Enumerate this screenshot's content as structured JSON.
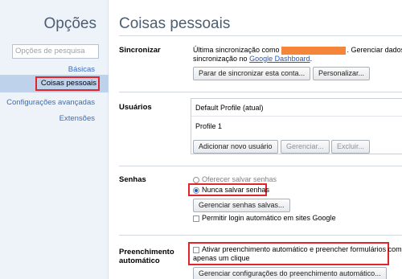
{
  "sidebar": {
    "title": "Opções",
    "search_placeholder": "Opções de pesquisa",
    "items": [
      {
        "label": "Básicas"
      },
      {
        "label": "Coisas pessoais"
      },
      {
        "label": "Configurações avançadas"
      },
      {
        "label": "Extensões"
      }
    ],
    "selected_item": "Coisas pessoais"
  },
  "main": {
    "title": "Coisas pessoais",
    "sync": {
      "label": "Sincronizar",
      "status_prefix": "Última sincronização como",
      "status_suffix": ". Gerenciar dados de",
      "status_line2": "sincronização no",
      "dashboard_link": "Google Dashboard",
      "status_end": ".",
      "stop_button": "Parar de sincronizar esta conta...",
      "customize_button": "Personalizar..."
    },
    "users": {
      "label": "Usuários",
      "profiles": [
        "Default Profile (atual)",
        "Profile 1"
      ],
      "add_button": "Adicionar novo usuário",
      "manage_button": "Gerenciar...",
      "delete_button": "Excluir..."
    },
    "passwords": {
      "label": "Senhas",
      "offer_option": "Oferecer salvar senhas",
      "never_option": "Nunca salvar senhas",
      "selected_option": "Nunca salvar senhas",
      "manage_button": "Gerenciar senhas salvas...",
      "auto_login": "Permitir login automático em sites Google",
      "auto_login_checked": false
    },
    "autofill": {
      "label_line1": "Preenchimento",
      "label_line2": "automático",
      "enable_line1": "Ativar preenchimento automático e preencher formulários com",
      "enable_line2": "apenas um clique",
      "enable_checked": false,
      "manage_button": "Gerenciar configurações do preenchimento automático..."
    }
  },
  "colors": {
    "highlight_border": "#e0262a",
    "redaction": "#f58539",
    "sidebar_bg": "#eef3fa",
    "selected_nav_bg": "#bfd2ec",
    "link": "#2a55b5"
  }
}
